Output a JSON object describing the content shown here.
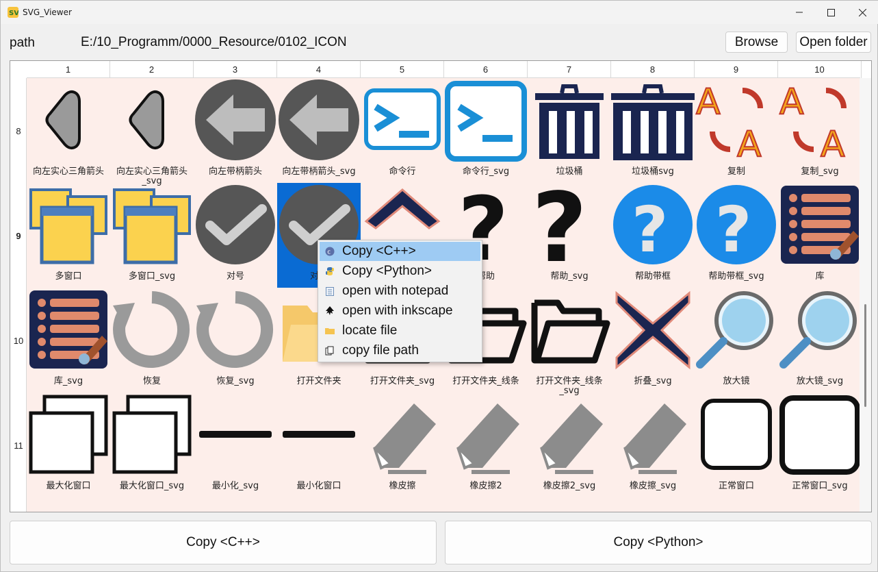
{
  "window": {
    "title": "SVG_Viewer"
  },
  "toolbar": {
    "path_label": "path",
    "path_value": "E:/10_Programm/0000_Resource/0102_ICON",
    "browse_label": "Browse",
    "open_folder_label": "Open folder"
  },
  "grid": {
    "columns": [
      "1",
      "2",
      "3",
      "4",
      "5",
      "6",
      "7",
      "8",
      "9",
      "10"
    ],
    "rows": [
      "8",
      "9",
      "10",
      "11"
    ],
    "cells": [
      [
        "向左实心三角箭头",
        "向左实心三角箭头_svg",
        "向左带柄箭头",
        "向左带柄箭头_svg",
        "命令行",
        "命令行_svg",
        "垃圾桶",
        "垃圾桶svg",
        "复制",
        "复制_svg"
      ],
      [
        "多窗口",
        "多窗口_svg",
        "对号",
        "对号",
        "",
        "帮助",
        "帮助_svg",
        "帮助带框",
        "帮助带框_svg",
        "库"
      ],
      [
        "库_svg",
        "恢复",
        "恢复_svg",
        "打开文件夹",
        "打开文件夹_svg",
        "打开文件夹_线条",
        "打开文件夹_线条_svg",
        "折叠_svg",
        "放大镜",
        "放大镜_svg"
      ],
      [
        "最大化窗口",
        "最大化窗口_svg",
        "最小化_svg",
        "最小化窗口",
        "橡皮擦",
        "橡皮擦2",
        "橡皮擦2_svg",
        "橡皮擦_svg",
        "正常窗口",
        "正常窗口_svg"
      ]
    ],
    "selected_cell": "对号"
  },
  "context_menu": {
    "items": [
      {
        "label": "Copy <C++>",
        "icon": "cpp-icon",
        "highlighted": true
      },
      {
        "label": "Copy <Python>",
        "icon": "python-icon"
      },
      {
        "label": "open with notepad",
        "icon": "notepad-icon"
      },
      {
        "label": "open with inkscape",
        "icon": "inkscape-icon"
      },
      {
        "label": "locate file",
        "icon": "folder-icon"
      },
      {
        "label": "copy file path",
        "icon": "copy-path-icon"
      }
    ]
  },
  "bottom": {
    "copy_cpp_label": "Copy <C++>",
    "copy_python_label": "Copy <Python>"
  },
  "colors": {
    "highlight": "#9ecbf3",
    "selection": "#0a6bd3",
    "cell_bg": "#fdeeea"
  }
}
